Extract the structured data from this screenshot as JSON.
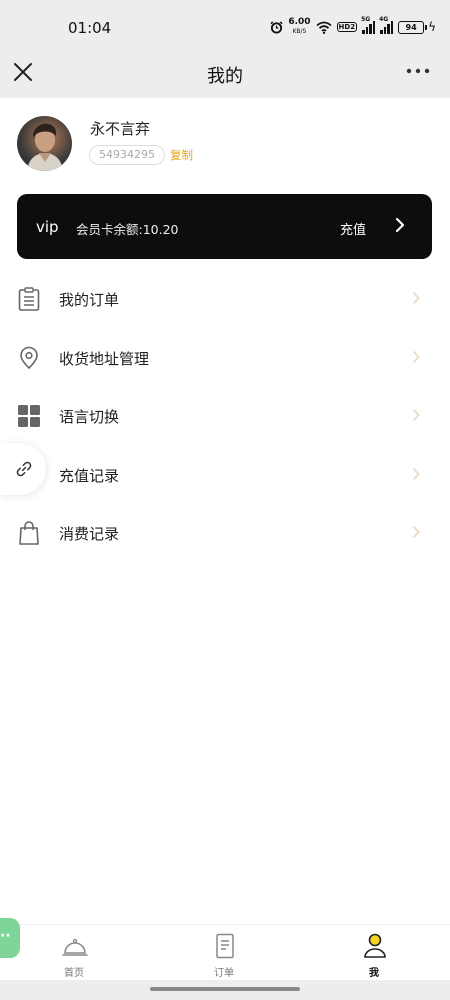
{
  "status_bar": {
    "time": "01:04",
    "net_speed_value": "6.00",
    "net_speed_unit": "KB/S",
    "hd_label": "HD2",
    "sig1_tag": "5G",
    "sig2_tag": "4G",
    "battery": "94"
  },
  "nav": {
    "title": "我的",
    "close_icon": "close-icon",
    "more_icon": "more-icon"
  },
  "profile": {
    "name": "永不言弃",
    "uid": "54934295",
    "copy_label": "复制"
  },
  "vip_card": {
    "label": "vip",
    "balance_text": "会员卡余额:10.20",
    "recharge_label": "充值"
  },
  "menu": [
    {
      "label": "我的订单",
      "icon": "order-list-icon"
    },
    {
      "label": "收货地址管理",
      "icon": "location-pin-icon"
    },
    {
      "label": "语言切换",
      "icon": "grid-icon"
    },
    {
      "label": "充值记录",
      "icon": "link-icon"
    },
    {
      "label": "消费记录",
      "icon": "shopping-bag-icon"
    }
  ],
  "tabs": [
    {
      "label": "首页",
      "icon": "service-bell-icon",
      "active": false
    },
    {
      "label": "订单",
      "icon": "order-document-icon",
      "active": false
    },
    {
      "label": "我",
      "icon": "user-icon",
      "active": true
    }
  ],
  "colors": {
    "accent": "#e8a31a",
    "vip_card": "#0d0d0d",
    "background": "#ededed",
    "active_tab_dot": "#f5d423",
    "float_tab": "#7fd49a"
  }
}
